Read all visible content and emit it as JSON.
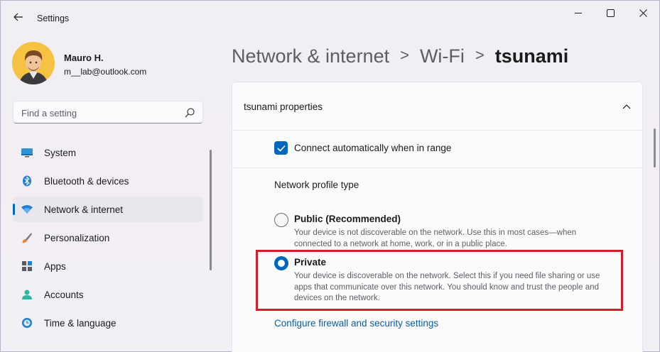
{
  "window": {
    "app_title": "Settings",
    "back_icon": "arrow-left-icon",
    "controls": [
      "minimize-icon",
      "maximize-icon",
      "close-icon"
    ]
  },
  "user": {
    "name": "Mauro H.",
    "email": "m__lab@outlook.com"
  },
  "search": {
    "placeholder": "Find a setting",
    "icon": "search-icon"
  },
  "sidebar": {
    "items": [
      {
        "label": "System",
        "icon": "monitor-icon",
        "selected": false
      },
      {
        "label": "Bluetooth & devices",
        "icon": "bluetooth-icon",
        "selected": false
      },
      {
        "label": "Network & internet",
        "icon": "wifi-icon",
        "selected": true
      },
      {
        "label": "Personalization",
        "icon": "brush-icon",
        "selected": false
      },
      {
        "label": "Apps",
        "icon": "apps-icon",
        "selected": false
      },
      {
        "label": "Accounts",
        "icon": "person-icon",
        "selected": false
      },
      {
        "label": "Time & language",
        "icon": "globe-clock-icon",
        "selected": false
      }
    ]
  },
  "breadcrumb": {
    "items": [
      "Network & internet",
      "Wi-Fi",
      "tsunami"
    ],
    "separator": ">"
  },
  "properties": {
    "title": "tsunami properties",
    "connect_auto": {
      "label": "Connect automatically when in range",
      "checked": true
    },
    "profile_type_label": "Network profile type",
    "options": [
      {
        "title": "Public (Recommended)",
        "description": "Your device is not discoverable on the network. Use this in most cases—when connected to a network at home, work, or in a public place.",
        "selected": false
      },
      {
        "title": "Private",
        "description": "Your device is discoverable on the network. Select this if you need file sharing or use apps that communicate over this network. You should know and trust the people and devices on the network.",
        "selected": true
      }
    ],
    "firewall_link": "Configure firewall and security settings"
  },
  "colors": {
    "accent": "#0067c0",
    "highlight": "#d61c2a",
    "background": "#f1eef4"
  }
}
